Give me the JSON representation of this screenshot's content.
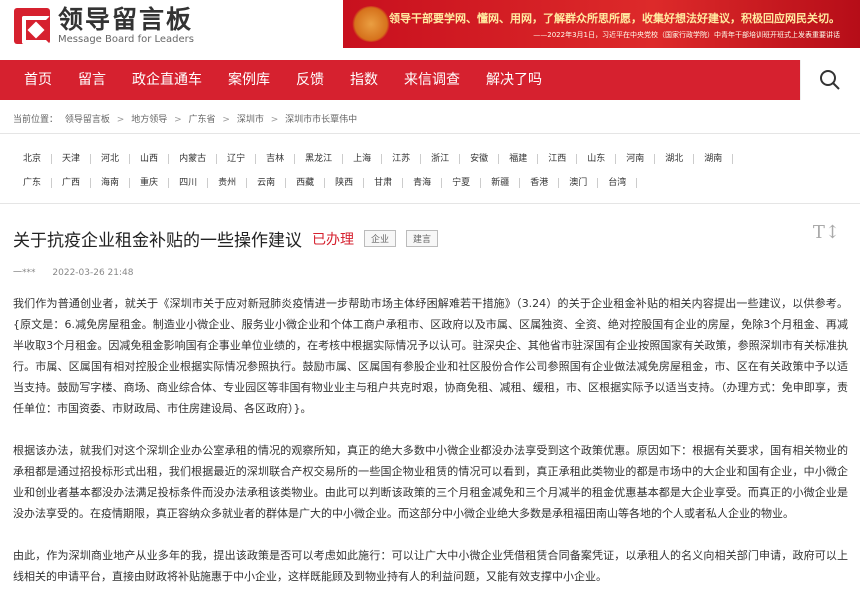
{
  "logo": {
    "title": "领导留言板",
    "subtitle": "Message Board for Leaders"
  },
  "banner": {
    "quote": "领导干部要学网、懂网、用网，了解群众所思所愿，收集好想法好建议，积极回应网民关切。",
    "source": "——2022年3月1日，习近平在中央党校（国家行政学院）中青年干部培训班开班式上发表重要讲话"
  },
  "nav": [
    "首页",
    "留言",
    "政企直通车",
    "案例库",
    "反馈",
    "指数",
    "来信调查",
    "解决了吗"
  ],
  "breadcrumb": {
    "label": "当前位置：",
    "items": [
      "领导留言板",
      "地方领导",
      "广东省",
      "深圳市",
      "深圳市市长覃伟中"
    ],
    "separator": ">"
  },
  "regions": {
    "row1": [
      "北京",
      "天津",
      "河北",
      "山西",
      "内蒙古",
      "辽宁",
      "吉林",
      "黑龙江",
      "上海",
      "江苏",
      "浙江",
      "安徽",
      "福建",
      "江西",
      "山东",
      "河南",
      "湖北",
      "湖南"
    ],
    "row2": [
      "广东",
      "广西",
      "海南",
      "重庆",
      "四川",
      "贵州",
      "云南",
      "西藏",
      "陕西",
      "甘肃",
      "青海",
      "宁夏",
      "新疆",
      "香港",
      "澳门",
      "台湾"
    ]
  },
  "post": {
    "title": "关于抗疫企业租金补贴的一些操作建议",
    "status": "已办理",
    "tags": [
      "企业",
      "建言"
    ],
    "font_toggle": "T↕",
    "author": "一***",
    "time": "2022-03-26 21:48",
    "paragraphs": [
      "我们作为普通创业者，就关于《深圳市关于应对新冠肺炎疫情进一步帮助市场主体纾困解难若干措施》（3.24）的关于企业租金补贴的相关内容提出一些建议，以供参考。{原文是：6.减免房屋租金。制造业小微企业、服务业小微企业和个体工商户承租市、区政府以及市属、区属独资、全资、绝对控股国有企业的房屋，免除3个月租金、再减半收取3个月租金。因减免租金影响国有企事业单位业绩的，在考核中根据实际情况予以认可。驻深央企、其他省市驻深国有企业按照国家有关政策，参照深圳市有关标准执行。市属、区属国有相对控股企业根据实际情况参照执行。鼓励市属、区属国有参股企业和社区股份合作公司参照国有企业做法减免房屋租金，市、区在有关政策中予以适当支持。鼓励写字楼、商场、商业综合体、专业园区等非国有物业业主与租户共克时艰，协商免租、减租、缓租，市、区根据实际予以适当支持。（办理方式：免申即享，责任单位：市国资委、市财政局、市住房建设局、各区政府）}。",
      "根据该办法，就我们对这个深圳企业办公室承租的情况的观察所知，真正的绝大多数中小微企业都没办法享受到这个政策优惠。原因如下：根据有关要求，国有相关物业的承租都是通过招投标形式出租，我们根据最近的深圳联合产权交易所的一些国企物业租赁的情况可以看到，真正承租此类物业的都是市场中的大企业和国有企业，中小微企业和创业者基本都没办法满足投标条件而没办法承租该类物业。由此可以判断该政策的三个月租金减免和三个月减半的租金优惠基本都是大企业享受。而真正的小微企业是没办法享受的。在疫情期限，真正容纳众多就业者的群体是广大的中小微企业。而这部分中小微企业绝大多数是承租福田南山等各地的个人或者私人企业的物业。",
      "由此，作为深圳商业地产从业多年的我，提出该政策是否可以考虑如此施行：可以让广大中小微企业凭借租赁合同备案凭证，以承租人的名义向相关部门申请，政府可以上线相关的申请平台，直接由财政将补贴施惠于中小企业，这样既能顾及到物业持有人的利益问题，又能有效支撑中小企业。"
    ]
  },
  "colors": {
    "brand_red": "#d6212f",
    "status_red": "#d6212f"
  }
}
